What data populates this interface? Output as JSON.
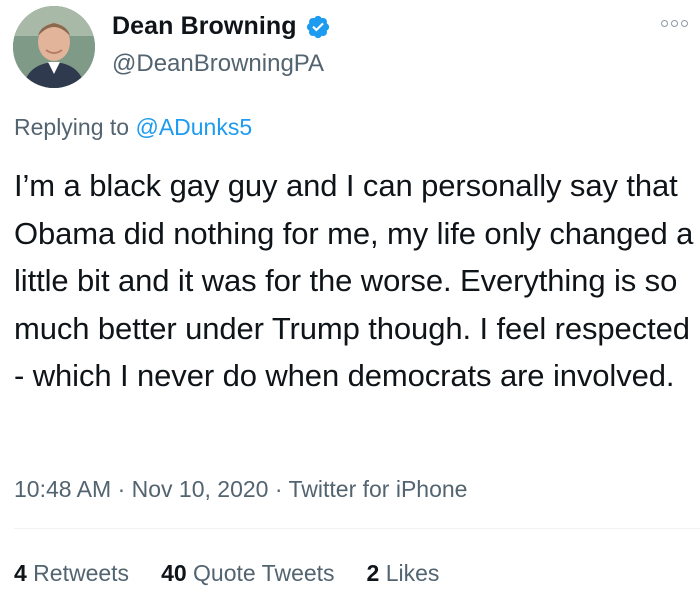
{
  "author": {
    "display_name": "Dean Browning",
    "handle": "@DeanBrowningPA",
    "verified_icon": "verified-badge-icon",
    "avatar": "avatar-photo"
  },
  "reply": {
    "prefix": "Replying to ",
    "handle": "@ADunks5"
  },
  "tweet": {
    "text": "I’m a black gay guy and I can personally say that Obama did nothing for me, my life only changed a little bit and it was for the worse. Everything is so much better under Trump though. I feel respected - which I never do when democrats are involved."
  },
  "meta": {
    "time": "10:48 AM",
    "separator1": " · ",
    "date": "Nov 10, 2020",
    "separator2": " · ",
    "source": "Twitter for iPhone"
  },
  "stats": {
    "retweets_count": "4",
    "retweets_label": " Retweets",
    "quotes_count": "40",
    "quotes_label": " Quote Tweets",
    "likes_count": "2",
    "likes_label": " Likes"
  },
  "colors": {
    "accent": "#1d9bf0",
    "text_primary": "#0f1419",
    "text_secondary": "#536471"
  }
}
